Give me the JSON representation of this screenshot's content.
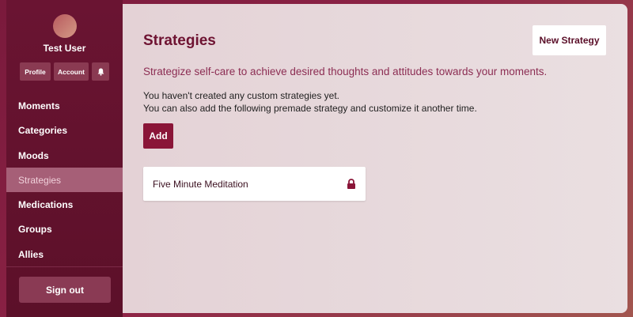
{
  "user": {
    "name": "Test User"
  },
  "user_actions": {
    "profile_label": "Profile",
    "account_label": "Account",
    "notifications_icon": "bell-icon"
  },
  "nav": {
    "items": [
      {
        "label": "Moments"
      },
      {
        "label": "Categories"
      },
      {
        "label": "Moods"
      },
      {
        "label": "Strategies",
        "active": true
      },
      {
        "label": "Medications"
      },
      {
        "label": "Groups"
      },
      {
        "label": "Allies"
      }
    ],
    "signout_label": "Sign out"
  },
  "page": {
    "title": "Strategies",
    "new_button_label": "New Strategy",
    "subtitle": "Strategize self-care to achieve desired thoughts and attitudes towards your moments.",
    "empty_line_1": "You haven't created any custom strategies yet.",
    "empty_line_2": "You can also add the following premade strategy and customize it another time.",
    "add_button_label": "Add"
  },
  "strategies": [
    {
      "name": "Five Minute Meditation",
      "icon": "lock-icon"
    }
  ],
  "colors": {
    "accent": "#8a1538",
    "title": "#6e1332",
    "subtitle": "#8c2d53",
    "sidebar": "#5c1029"
  }
}
